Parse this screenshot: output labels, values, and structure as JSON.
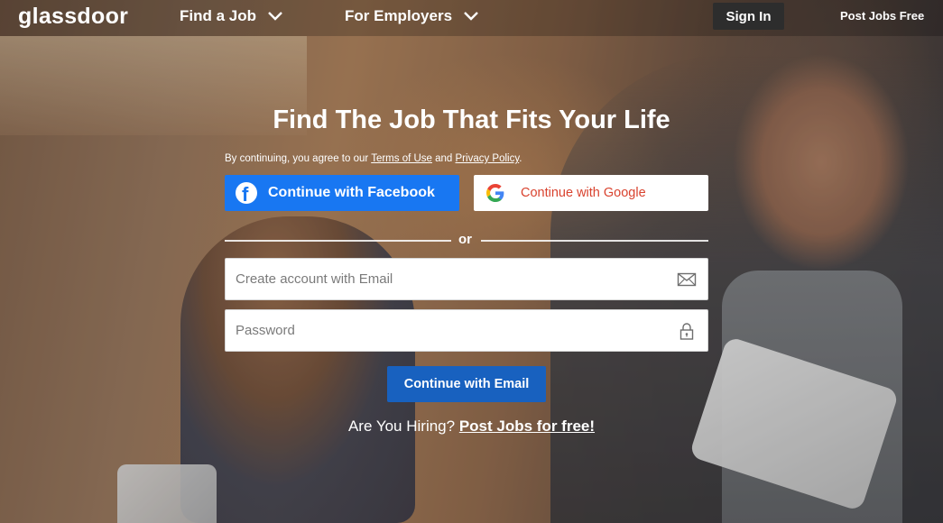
{
  "nav": {
    "logo": "glassdoor",
    "find_job": "Find a Job",
    "for_employers": "For Employers",
    "sign_in": "Sign In",
    "post_jobs": "Post Jobs Free"
  },
  "main": {
    "headline": "Find The Job That Fits Your Life",
    "terms": {
      "prefix": "By continuing, you agree to our ",
      "terms_link": "Terms of Use",
      "and": " and ",
      "privacy_link": "Privacy Policy",
      "suffix": "."
    },
    "facebook_button": "Continue with Facebook",
    "google_button": "Continue with Google",
    "or": "or",
    "email_placeholder": "Create account with Email",
    "password_placeholder": "Password",
    "email_button": "Continue with Email",
    "hiring": {
      "question": "Are You Hiring? ",
      "link": "Post Jobs for free!"
    }
  },
  "colors": {
    "facebook": "#1877f2",
    "google_text": "#d9432f",
    "email_button": "#1861bf",
    "signin_bg": "#2d2d2d"
  },
  "icons": {
    "chevron": "chevron-down-icon",
    "facebook": "facebook-icon",
    "google": "google-icon",
    "email": "envelope-icon",
    "password": "lock-icon"
  }
}
